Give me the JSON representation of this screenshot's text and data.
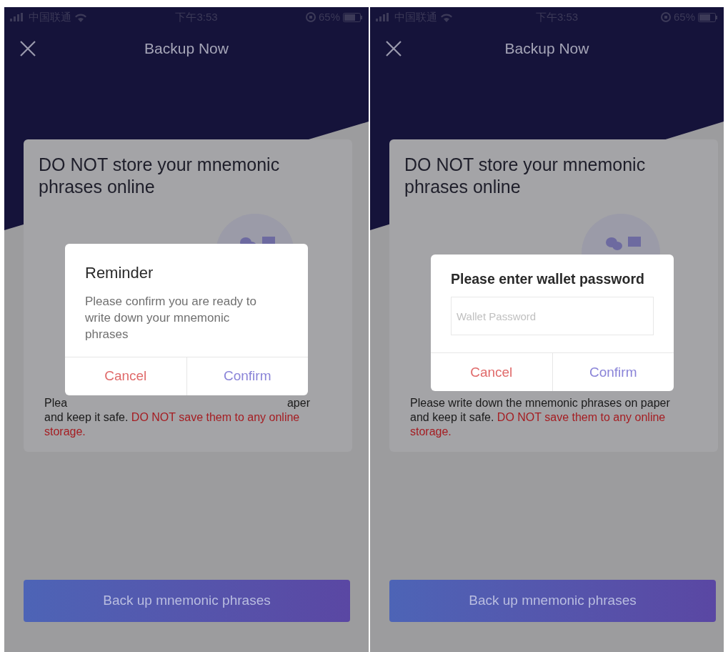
{
  "screens": [
    {
      "status_bar": {
        "carrier": "中国联通",
        "time": "下午3:53",
        "battery": "65%"
      },
      "title": "Backup Now",
      "card_title": "DO NOT store your mnemonic phrases online",
      "note": {
        "partial_line": [
          "Plea",
          "aper"
        ],
        "segments": [
          {
            "text": "and keep it safe. ",
            "alert": false
          },
          {
            "text": "DO NOT save them to any online storage.",
            "alert": true
          }
        ]
      },
      "action": "Back up mnemonic phrases",
      "dialog": {
        "kind": "reminder",
        "title": "Reminder",
        "message": "Please confirm you are ready to write down your mnemonic phrases",
        "buttons": [
          {
            "label": "Cancel",
            "kind": "cancel"
          },
          {
            "label": "Confirm",
            "kind": "confirm"
          }
        ]
      }
    },
    {
      "status_bar": {
        "carrier": "中国联通",
        "time": "下午3:53",
        "battery": "65%"
      },
      "title": "Backup Now",
      "card_title": "DO NOT store your mnemonic phrases online",
      "note": {
        "segments": [
          {
            "text": "Please write down the mnemonic phrases on paper and keep it safe. ",
            "alert": false
          },
          {
            "text": "DO NOT save them to any online storage.",
            "alert": true
          }
        ]
      },
      "action": "Back up mnemonic phrases",
      "dialog": {
        "kind": "password",
        "title": "Please enter wallet password",
        "placeholder": "Wallet Password",
        "buttons": [
          {
            "label": "Cancel",
            "kind": "cancel"
          },
          {
            "label": "Confirm",
            "kind": "confirm"
          }
        ]
      }
    }
  ]
}
